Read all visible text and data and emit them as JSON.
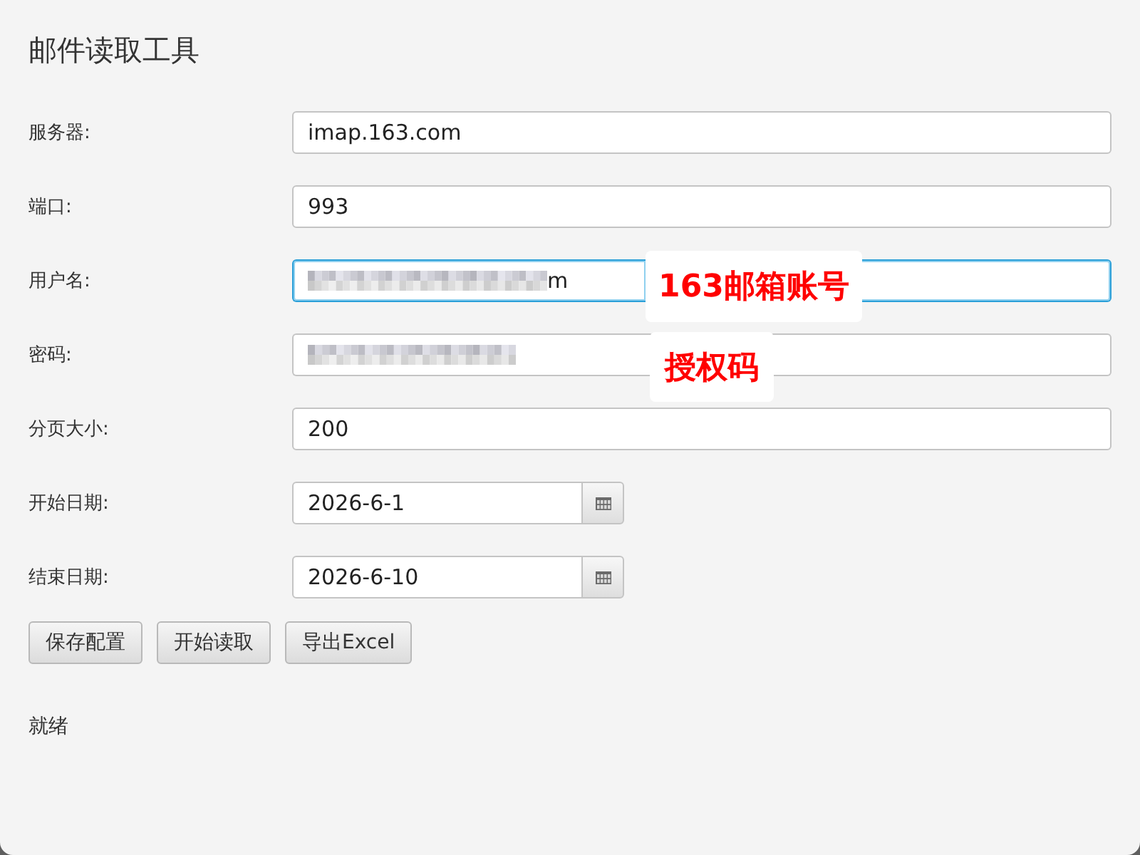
{
  "window": {
    "title": "邮件读取工具"
  },
  "fields": [
    {
      "kind": "text",
      "label": "服务器:",
      "value": "imap.163.com",
      "focused": false
    },
    {
      "kind": "text",
      "label": "端口:",
      "value": "993",
      "focused": false
    },
    {
      "kind": "redacted",
      "label": "用户名:",
      "visible_text": "m",
      "focused": true,
      "annotation": "163邮箱账号"
    },
    {
      "kind": "redacted",
      "label": "密码:",
      "focused": false,
      "annotation": "授权码"
    },
    {
      "kind": "text",
      "label": "分页大小:",
      "value": "200",
      "focused": false
    },
    {
      "kind": "date",
      "label": "开始日期:",
      "value": "2026-6-1",
      "focused": false
    },
    {
      "kind": "date",
      "label": "结束日期:",
      "value": "2026-6-10",
      "focused": false
    }
  ],
  "buttons": [
    "保存配置",
    "开始读取",
    "导出Excel"
  ],
  "status": "就绪"
}
